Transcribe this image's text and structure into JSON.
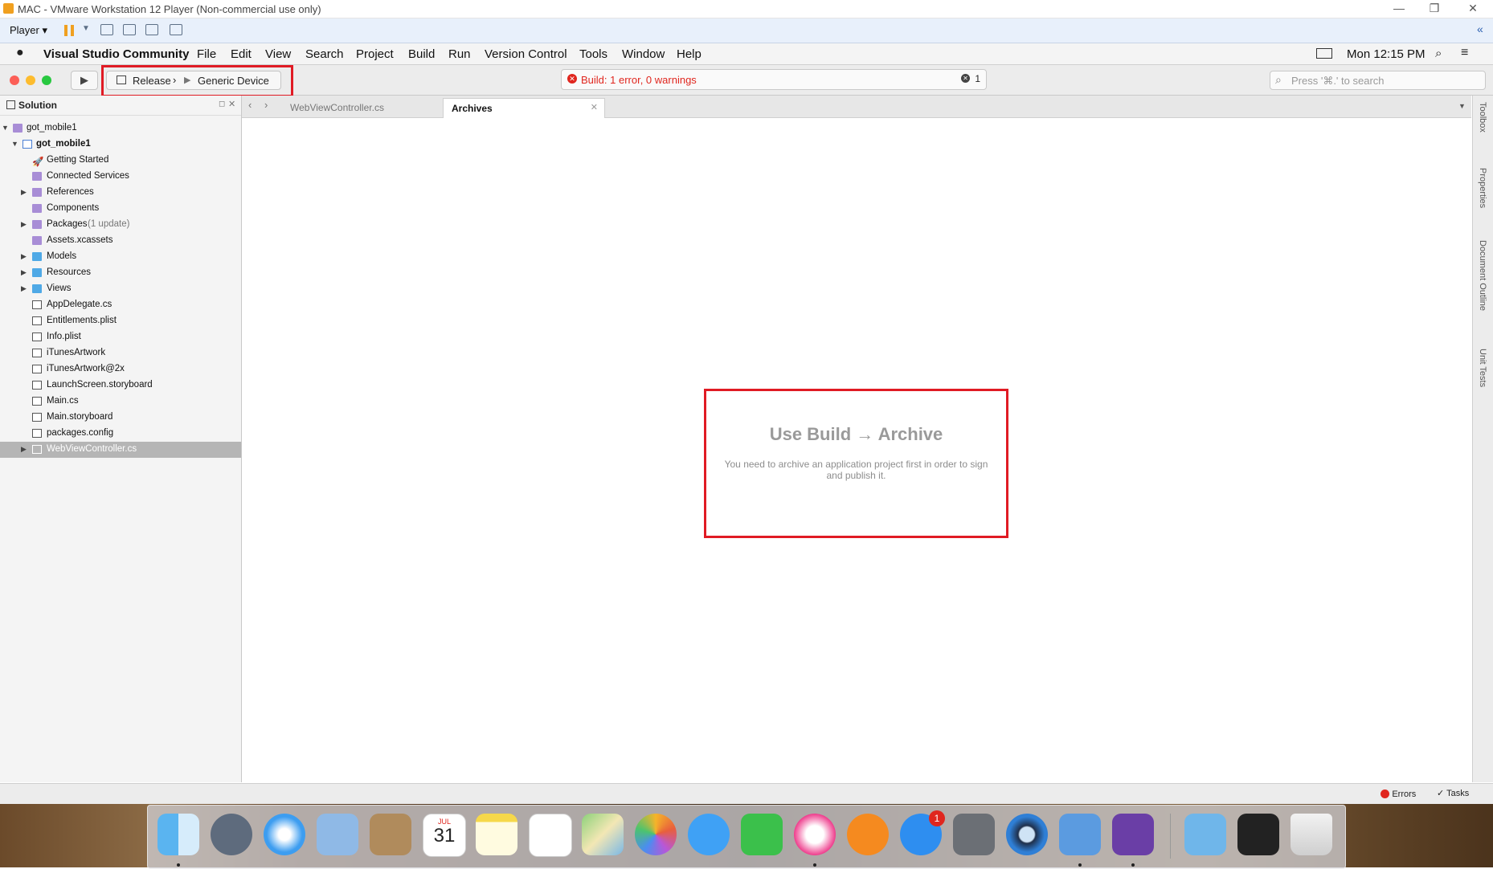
{
  "vm_window": {
    "title": "MAC - VMware Workstation 12 Player (Non-commercial use only)",
    "player_menu": "Player ▾"
  },
  "menubar": {
    "app_name": "Visual Studio Community",
    "items": [
      "File",
      "Edit",
      "View",
      "Search",
      "Project",
      "Build",
      "Run",
      "Version Control",
      "Tools",
      "Window",
      "Help"
    ],
    "clock": "Mon 12:15 PM"
  },
  "toolbar": {
    "configuration": "Release",
    "separator": "›",
    "device": "Generic Device",
    "build_status": "Build: 1 error, 0 warnings",
    "error_count": "1",
    "search_placeholder": "Press '⌘.' to search"
  },
  "solution_pad": {
    "title": "Solution",
    "items": [
      {
        "label": "got_mobile1",
        "note": ""
      },
      {
        "label": "got_mobile1",
        "note": ""
      },
      {
        "label": "Getting Started",
        "note": ""
      },
      {
        "label": "Connected Services",
        "note": ""
      },
      {
        "label": "References",
        "note": ""
      },
      {
        "label": "Components",
        "note": ""
      },
      {
        "label": "Packages",
        "note": "(1 update)"
      },
      {
        "label": "Assets.xcassets",
        "note": ""
      },
      {
        "label": "Models",
        "note": ""
      },
      {
        "label": "Resources",
        "note": ""
      },
      {
        "label": "Views",
        "note": ""
      },
      {
        "label": "AppDelegate.cs",
        "note": ""
      },
      {
        "label": "Entitlements.plist",
        "note": ""
      },
      {
        "label": "Info.plist",
        "note": ""
      },
      {
        "label": "iTunesArtwork",
        "note": ""
      },
      {
        "label": "iTunesArtwork@2x",
        "note": ""
      },
      {
        "label": "LaunchScreen.storyboard",
        "note": ""
      },
      {
        "label": "Main.cs",
        "note": ""
      },
      {
        "label": "Main.storyboard",
        "note": ""
      },
      {
        "label": "packages.config",
        "note": ""
      },
      {
        "label": "WebViewController.cs",
        "note": ""
      }
    ]
  },
  "tabs": [
    {
      "label": "WebViewController.cs"
    },
    {
      "label": "Archives"
    }
  ],
  "archives": {
    "title": "Use Build → Archive",
    "description": "You need to archive an application project first in order to sign and publish it."
  },
  "right_dock": [
    "Toolbox",
    "Properties",
    "Document Outline",
    "Unit Tests"
  ],
  "status_bar": {
    "errors": "Errors",
    "tasks": "Tasks"
  },
  "dock": {
    "calendar_month": "JUL",
    "calendar_day": "31",
    "app_store_badge": "1"
  },
  "colors": {
    "error": "#e0261e",
    "highlight": "#e01b24",
    "selection": "#b5b5b5"
  }
}
